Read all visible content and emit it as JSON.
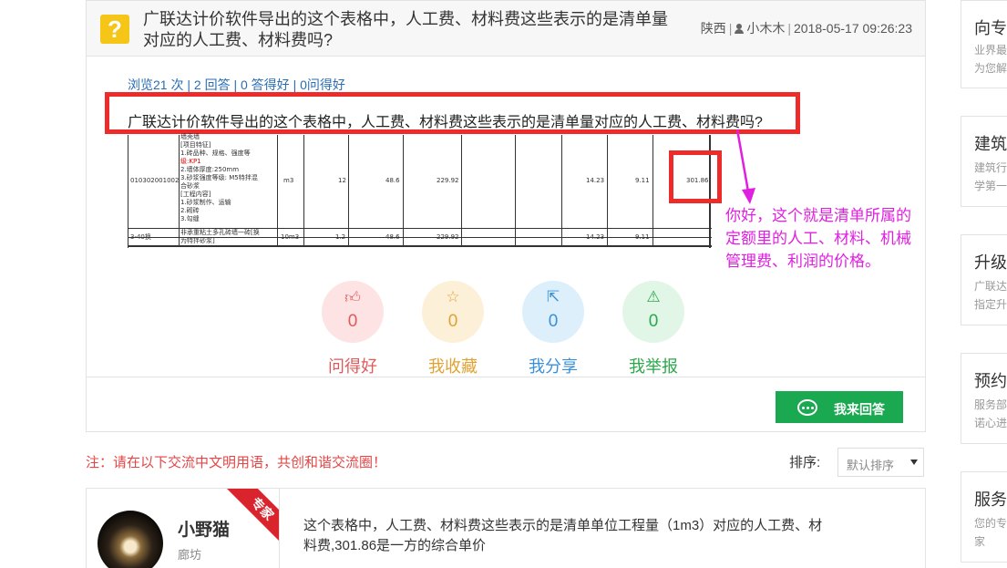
{
  "question": {
    "icon": "question-mark-icon",
    "title": "广联达计价软件导出的这个表格中，人工费、材料费这些表示的是清单量对应的人工费、材料费吗?",
    "meta": {
      "region": "陕西",
      "author": "小木木",
      "datetime": "2018-05-17 09:26:23"
    },
    "stats": {
      "views": "浏览21 次",
      "answers": "2 回答",
      "good_answers": "0 答得好",
      "helpful": "0问得好"
    },
    "image": {
      "caption": "广联达计价软件导出的这个表格中，人工费、材料费这些表示的是清单量对应的人工费、材料费吗?",
      "table": {
        "row1_desc": [
          "墙壳墙",
          "[项目特征]",
          "1.砖品种、规格、强度等",
          "级:KP1",
          "2.墙体厚度:250mm",
          "3.砂浆强度等级:   M5特拌混",
          "合砂浆",
          "[工程内容]",
          "1.砂浆制作、运输",
          "2.砌砖",
          "3.勾缝"
        ],
        "row1": {
          "code": "010302001002",
          "unit": "m3",
          "qty": "12",
          "price1": "48.6",
          "price2": "229.92",
          "labor": "14.23",
          "mgmt": "9.11",
          "total": "301.86"
        },
        "row2_desc": [
          "非承重粘土多孔砖墙一砖[换",
          "为特拌砂浆]"
        ],
        "row2": {
          "code": "3-40换",
          "unit": "10m3",
          "qty": "1.2",
          "price1": "48.6",
          "price2": "229.92",
          "labor": "14.23",
          "mgmt": "9.11"
        }
      },
      "annotation": [
        "你好，这个就是清单所属的",
        "定额里的人工、材料、机械",
        "管理费、利润的价格。"
      ]
    },
    "actions": [
      {
        "icon": "thumbs-up-icon",
        "count": "0",
        "label": "问得好"
      },
      {
        "icon": "star-icon",
        "count": "0",
        "label": "我收藏"
      },
      {
        "icon": "share-icon",
        "count": "0",
        "label": "我分享"
      },
      {
        "icon": "warning-icon",
        "count": "0",
        "label": "我举报"
      }
    ],
    "answer_button": "我来回答"
  },
  "notice": "注：请在以下交流中文明用语，共创和谐交流圈！",
  "sort": {
    "label": "排序:",
    "selected": "默认排序"
  },
  "answer": {
    "name": "小野猫",
    "location": "廊坊",
    "badge": "专家",
    "text": "这个表格中，人工费、材料费这些表示的是清单单位工程量（1m3）对应的人工费、材料费,301.86是一方的综合单价"
  },
  "sidebar": [
    {
      "title": "向专",
      "desc": [
        "业界最",
        "为您解"
      ]
    },
    {
      "title": "建筑",
      "desc": [
        "建筑行",
        "学第一"
      ]
    },
    {
      "title": "升级",
      "desc": [
        "广联达",
        "指定升"
      ]
    },
    {
      "title": "预约",
      "desc": [
        "服务部",
        "诺心进"
      ]
    },
    {
      "title": "服务",
      "desc": [
        "您的专",
        "家"
      ]
    }
  ],
  "colors": {
    "accent_green": "#1aa851",
    "highlight_red": "#ee2b2b",
    "annotation_magenta": "#e020e0",
    "link_blue": "#2a6db5"
  }
}
